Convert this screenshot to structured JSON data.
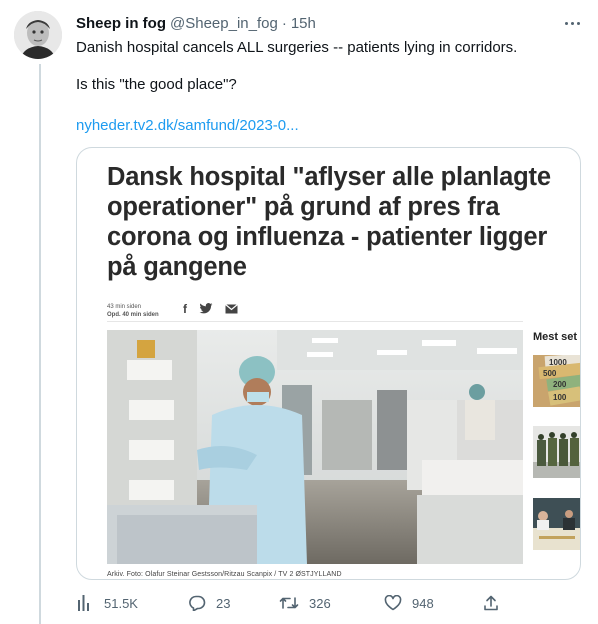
{
  "tweet": {
    "author_name": "Sheep in fog",
    "handle": "@Sheep_in_fog",
    "separator": "·",
    "time": "15h",
    "text_line1": "Danish hospital cancels ALL surgeries -- patients lying in corridors.",
    "text_line2": "Is this \"the good place\"?",
    "link_text": "nyheder.tv2.dk/samfund/2023-0..."
  },
  "card": {
    "headline": "Dansk hospital \"aflyser alle planlagte operationer\" på grund af pres fra corona og influenza - patienter ligger på gangene",
    "meta_posted": "43 min siden",
    "meta_updated": "Opd. 40 min siden",
    "share_facebook": "f",
    "photo_caption": "Arkiv. Foto: Olafur Steinar Gestsson/Ritzau Scanpix / TV 2 ØSTJYLLAND",
    "sidebar_title": "Mest set",
    "banknote_values": [
      "1000",
      "500",
      "200",
      "100"
    ]
  },
  "actions": {
    "views": "51.5K",
    "replies": "23",
    "retweets": "326",
    "likes": "948"
  },
  "icons": {
    "views": "bar-chart-icon",
    "reply": "speech-bubble-icon",
    "retweet": "retweet-arrows-icon",
    "like": "heart-icon",
    "share": "upload-arrow-icon",
    "more": "more-dots-icon"
  },
  "colors": {
    "link": "#1d9bf0",
    "secondary_text": "#536471",
    "border": "#cfd9de"
  }
}
